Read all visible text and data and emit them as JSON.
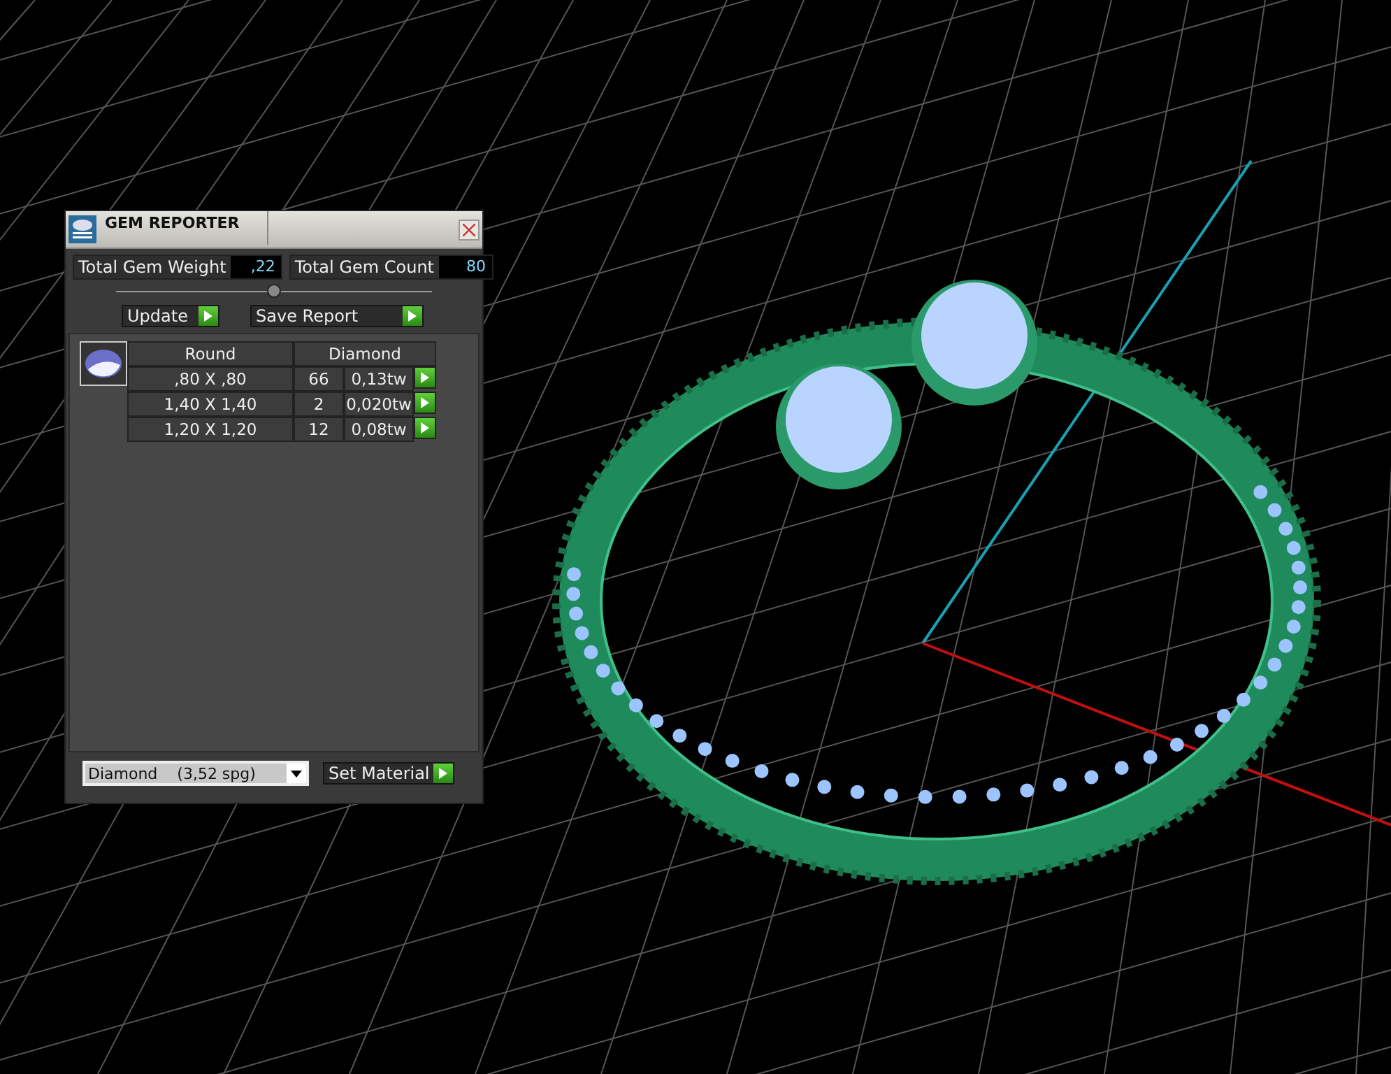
{
  "window": {
    "title": "GEM REPORTER"
  },
  "totals": [
    {
      "label": "Total Gem Weight",
      "value": ",22"
    },
    {
      "label": "Total Gem Count",
      "value": "80"
    }
  ],
  "slider": {
    "level": 0.5
  },
  "buttons": [
    {
      "label": "Update"
    },
    {
      "label": "Save Report"
    }
  ],
  "table": {
    "columns": [
      "Round",
      "Diamond"
    ],
    "rows": [
      {
        "size": ",80 X ,80",
        "count": "66",
        "weight": "0,13tw"
      },
      {
        "size": "1,40 X 1,40",
        "count": "2",
        "weight": "0,020tw"
      },
      {
        "size": "1,20 X 1,20",
        "count": "12",
        "weight": "0,08tw"
      }
    ]
  },
  "material": {
    "value": "Diamond    (3,52 spg)",
    "button": "Set Material"
  }
}
